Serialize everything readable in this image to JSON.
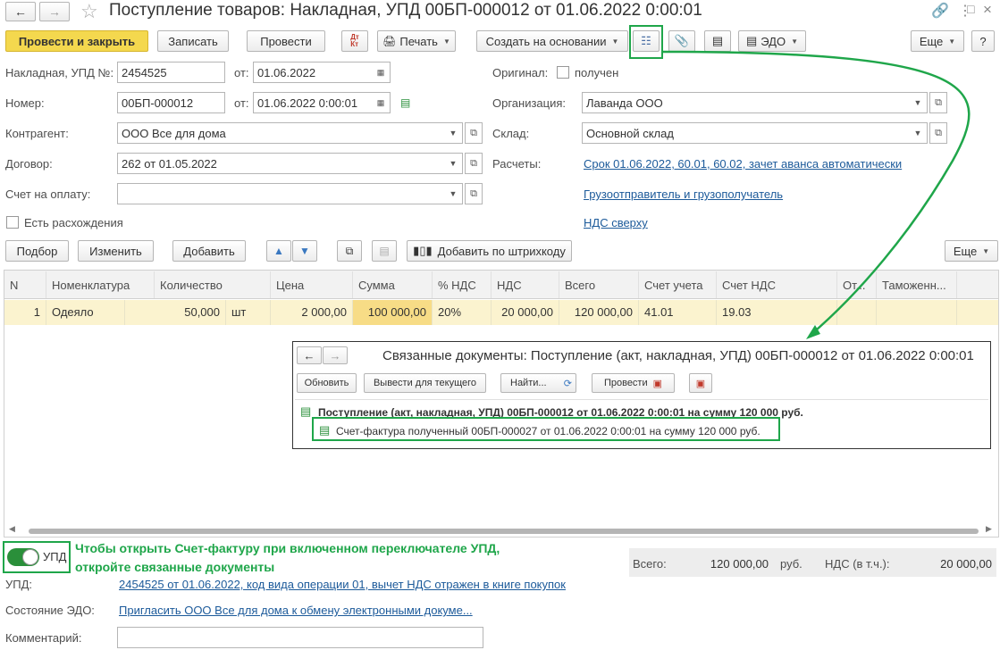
{
  "window": {
    "title": "Поступление товаров: Накладная, УПД 00БП-000012 от 01.06.2022 0:00:01"
  },
  "toolbar": {
    "post_close": "Провести и закрыть",
    "save": "Записать",
    "post": "Провести",
    "print": "Печать",
    "create_based": "Создать на основании",
    "edo": "ЭДО",
    "more": "Еще",
    "help": "?"
  },
  "form": {
    "invoice_label": "Накладная, УПД №:",
    "invoice_value": "2454525",
    "from_label": "от:",
    "invoice_date": "01.06.2022",
    "number_label": "Номер:",
    "number_value": "00БП-000012",
    "number_date": "01.06.2022  0:00:01",
    "counterparty_label": "Контрагент:",
    "counterparty_value": "ООО Все для дома",
    "contract_label": "Договор:",
    "contract_value": "262 от 01.05.2022",
    "payment_label": "Счет на оплату:",
    "payment_value": "",
    "discrepancy_label": "Есть расхождения",
    "original_label": "Оригинал:",
    "original_received": "получен",
    "org_label": "Организация:",
    "org_value": "Лаванда ООО",
    "warehouse_label": "Склад:",
    "warehouse_value": "Основной склад",
    "settlements_label": "Расчеты:",
    "settlements_link": "Срок 01.06.2022, 60.01, 60.02, зачет аванса автоматически",
    "shipper_link": "Грузоотправитель и грузополучатель",
    "vat_link": "НДС сверху"
  },
  "table_toolbar": {
    "select": "Подбор",
    "change": "Изменить",
    "add": "Добавить",
    "add_barcode": "Добавить по штрихкоду",
    "more": "Еще"
  },
  "table": {
    "headers": [
      "N",
      "Номенклатура",
      "Количество",
      "Цена",
      "Сумма",
      "% НДС",
      "НДС",
      "Всего",
      "Счет учета",
      "Счет НДС",
      "От...",
      "Таможенн..."
    ],
    "row": [
      "1",
      "Одеяло",
      "50,000",
      "шт",
      "2 000,00",
      "100 000,00",
      "20%",
      "20 000,00",
      "120 000,00",
      "41.01",
      "19.03"
    ]
  },
  "related": {
    "title": "Связанные документы: Поступление (акт, накладная, УПД) 00БП-000012 от 01.06.2022 0:00:01",
    "refresh": "Обновить",
    "output_current": "Вывести для текущего",
    "find": "Найти...",
    "post": "Провести",
    "root_doc": "Поступление (акт, накладная, УПД) 00БП-000012 от 01.06.2022 0:00:01 на сумму 120 000 руб.",
    "child_doc": "Счет-фактура полученный 00БП-000027 от 01.06.2022 0:00:01 на сумму 120 000 руб."
  },
  "footer": {
    "upd_toggle": "УПД",
    "hint": "Чтобы открыть Счет-фактуру при включенном переключателе УПД, откройте связанные документы",
    "total_label": "Всего:",
    "total_value": "120 000,00",
    "currency": "руб.",
    "vat_label": "НДС (в т.ч.):",
    "vat_value": "20 000,00",
    "upd_label": "УПД:",
    "upd_link": "2454525 от 01.06.2022, код вида операции 01, вычет НДС отражен в книге покупок",
    "edo_label": "Состояние ЭДО:",
    "edo_link": "Пригласить ООО Все для дома к обмену электронными докуме...",
    "comment_label": "Комментарий:",
    "comment_value": ""
  },
  "colors": {
    "accent_green": "#1fa64a",
    "primary_yellow": "#f4d84e",
    "row_highlight": "#fbf3cf",
    "link_blue": "#1c5a9a"
  }
}
